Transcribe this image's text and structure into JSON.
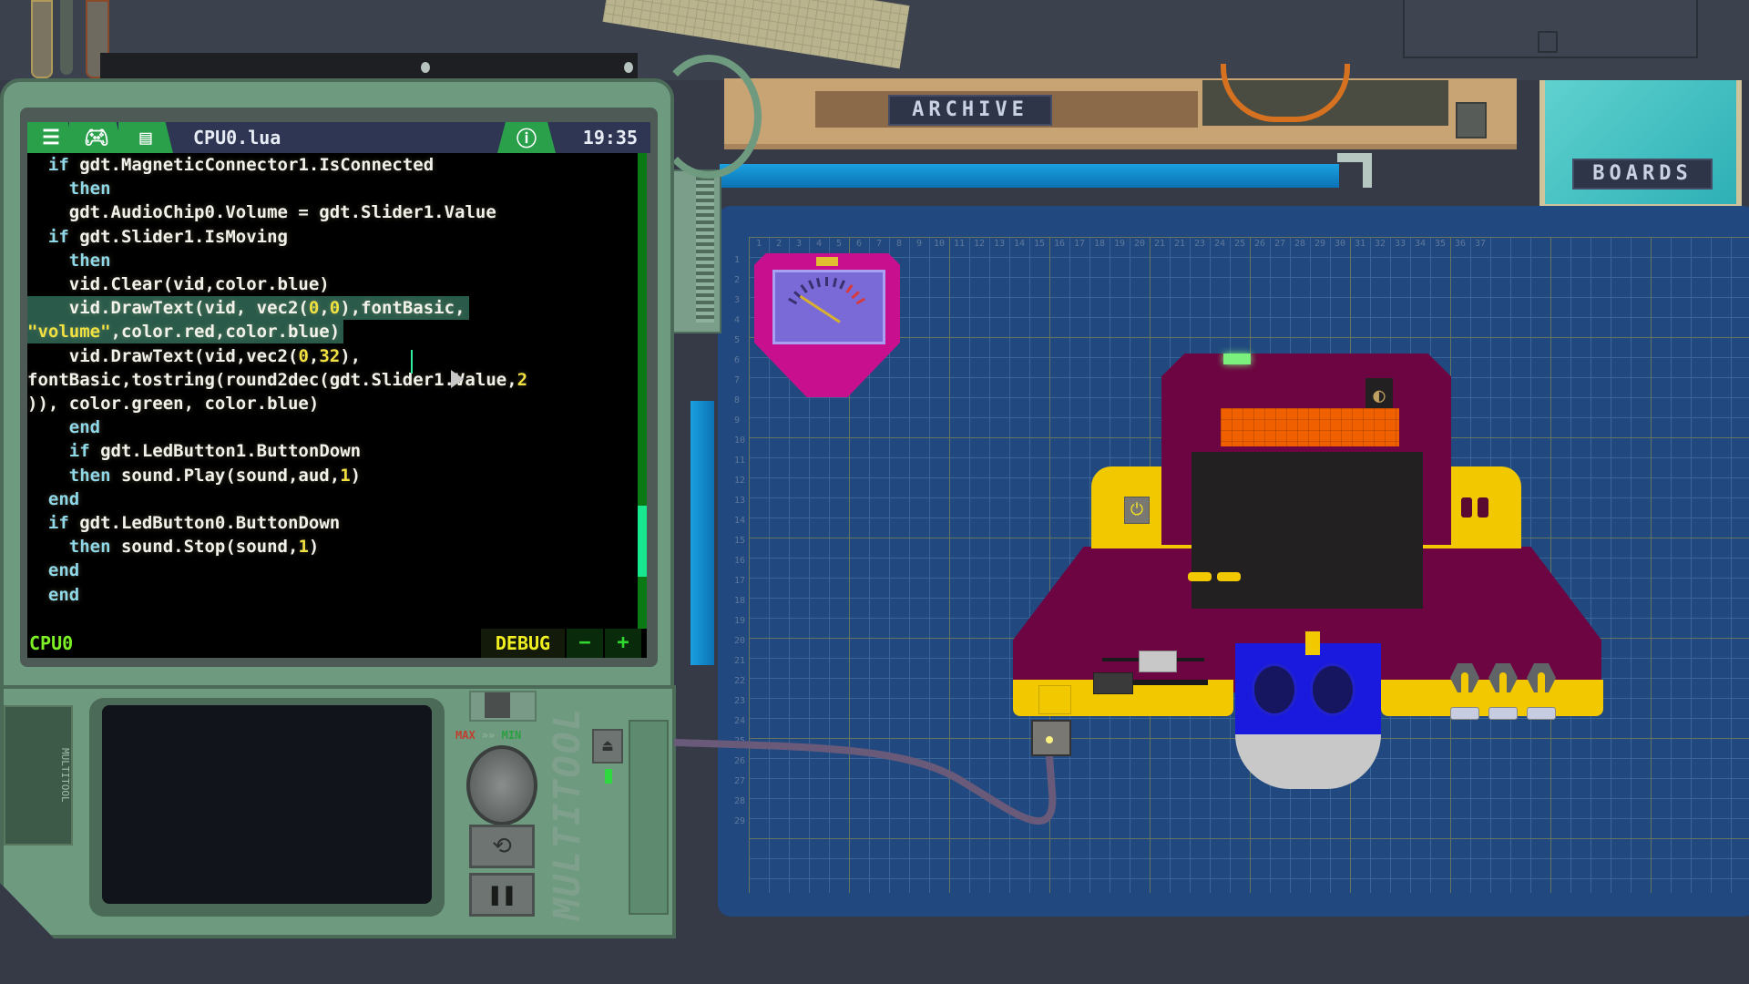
{
  "scene": {
    "shelves": {
      "archive_label": "ARCHIVE",
      "boards_label": "BOARDS"
    }
  },
  "editor": {
    "header": {
      "menu_icon": "hamburger-menu-icon",
      "gamepad_icon": "gamepad-add-icon",
      "file_icon": "document-icon",
      "file_name": "CPU0.lua",
      "info_icon": "info-icon",
      "time": "19:35"
    },
    "code_lines": [
      {
        "indent": "  ",
        "parts": [
          [
            "kw",
            "if"
          ],
          [
            "txt",
            " gdt.MagneticConnector1.IsConnected"
          ]
        ]
      },
      {
        "indent": "    ",
        "parts": [
          [
            "kw",
            "then"
          ]
        ]
      },
      {
        "indent": "    ",
        "parts": [
          [
            "txt",
            "gdt.AudioChip0.Volume = gdt.Slider1.Value"
          ]
        ]
      },
      {
        "indent": "  ",
        "parts": [
          [
            "kw",
            "if"
          ],
          [
            "txt",
            " gdt.Slider1.IsMoving"
          ]
        ]
      },
      {
        "indent": "    ",
        "parts": [
          [
            "kw",
            "then"
          ]
        ]
      },
      {
        "indent": "    ",
        "parts": [
          [
            "txt",
            "vid.Clear(vid,color.blue)"
          ]
        ]
      },
      {
        "indent": "    ",
        "selected": true,
        "parts": [
          [
            "txt",
            "vid.DrawText(vid, vec2("
          ],
          [
            "num",
            "0"
          ],
          [
            "txt",
            ","
          ],
          [
            "num",
            "0"
          ],
          [
            "txt",
            "),fontBasic,"
          ]
        ]
      },
      {
        "indent": "",
        "selected": true,
        "parts": [
          [
            "str",
            "\"volume\""
          ],
          [
            "txt",
            ",color.red,color.blue)"
          ]
        ]
      },
      {
        "indent": "    ",
        "parts": [
          [
            "txt",
            "vid.DrawText(vid,vec2("
          ],
          [
            "num",
            "0"
          ],
          [
            "txt",
            ","
          ],
          [
            "num",
            "32"
          ],
          [
            "txt",
            "),"
          ]
        ]
      },
      {
        "indent": "",
        "parts": [
          [
            "txt",
            "fontBasic,tostring(round2dec(gdt.Slider1.Value,"
          ],
          [
            "num",
            "2"
          ]
        ]
      },
      {
        "indent": "",
        "parts": [
          [
            "txt",
            ")), color.green, color.blue)"
          ]
        ]
      },
      {
        "indent": "    ",
        "parts": [
          [
            "kw",
            "end"
          ]
        ]
      },
      {
        "indent": "    ",
        "parts": [
          [
            "kw",
            "if"
          ],
          [
            "txt",
            " gdt.LedButton1.ButtonDown"
          ]
        ]
      },
      {
        "indent": "    ",
        "parts": [
          [
            "kw",
            "then"
          ],
          [
            "txt",
            " sound.Play(sound,aud,"
          ],
          [
            "num",
            "1"
          ],
          [
            "txt",
            ")"
          ]
        ]
      },
      {
        "indent": "  ",
        "parts": [
          [
            "kw",
            "end"
          ]
        ]
      },
      {
        "indent": "  ",
        "parts": [
          [
            "kw",
            "if"
          ],
          [
            "txt",
            " gdt.LedButton0.ButtonDown"
          ]
        ]
      },
      {
        "indent": "    ",
        "parts": [
          [
            "kw",
            "then"
          ],
          [
            "txt",
            " sound.Stop(sound,"
          ],
          [
            "num",
            "1"
          ],
          [
            "txt",
            ")"
          ]
        ]
      },
      {
        "indent": "  ",
        "parts": [
          [
            "kw",
            "end"
          ]
        ]
      },
      {
        "indent": "  ",
        "parts": [
          [
            "kw",
            "end"
          ]
        ]
      }
    ],
    "footer": {
      "cpu_label": "CPU0",
      "debug_label": "DEBUG",
      "minus_label": "−",
      "plus_label": "+"
    },
    "colors": {
      "header_tab": "#2aa04b",
      "keyword": "#8fd8e8",
      "number": "#f0e040",
      "text": "#f2f2ea",
      "cpu_label": "#7cf024",
      "debug_label": "#f0f020"
    }
  },
  "multitool": {
    "brand": "MULTITOOL",
    "side_plate": "MULTITOOL",
    "max_label": "MAX",
    "arrows": "»»",
    "min_label": "MIN",
    "reset_icon": "⟲",
    "pause_icon": "❚❚",
    "eject_icon": "⏏"
  },
  "board": {
    "ruler_top": [
      "1",
      "2",
      "3",
      "4",
      "5",
      "6",
      "7",
      "8",
      "9",
      "10",
      "11",
      "12",
      "13",
      "14",
      "15",
      "16",
      "17",
      "18",
      "19",
      "20",
      "21",
      "21",
      "23",
      "24",
      "25",
      "26",
      "27",
      "28",
      "29",
      "30",
      "31",
      "32",
      "33",
      "34",
      "35",
      "36",
      "37"
    ],
    "ruler_left": [
      "1",
      "2",
      "3",
      "4",
      "5",
      "6",
      "7",
      "8",
      "9",
      "10",
      "11",
      "12",
      "13",
      "14",
      "15",
      "16",
      "17",
      "18",
      "19",
      "20",
      "21",
      "22",
      "23",
      "24",
      "25",
      "26",
      "27",
      "28",
      "29"
    ]
  },
  "device": {
    "dial_icon": "◐",
    "power_icon": "⏻",
    "colors": {
      "body": "#6c0541",
      "accent": "#f2c800",
      "lcd": "#f06000",
      "speaker": "#1a1adf"
    }
  }
}
